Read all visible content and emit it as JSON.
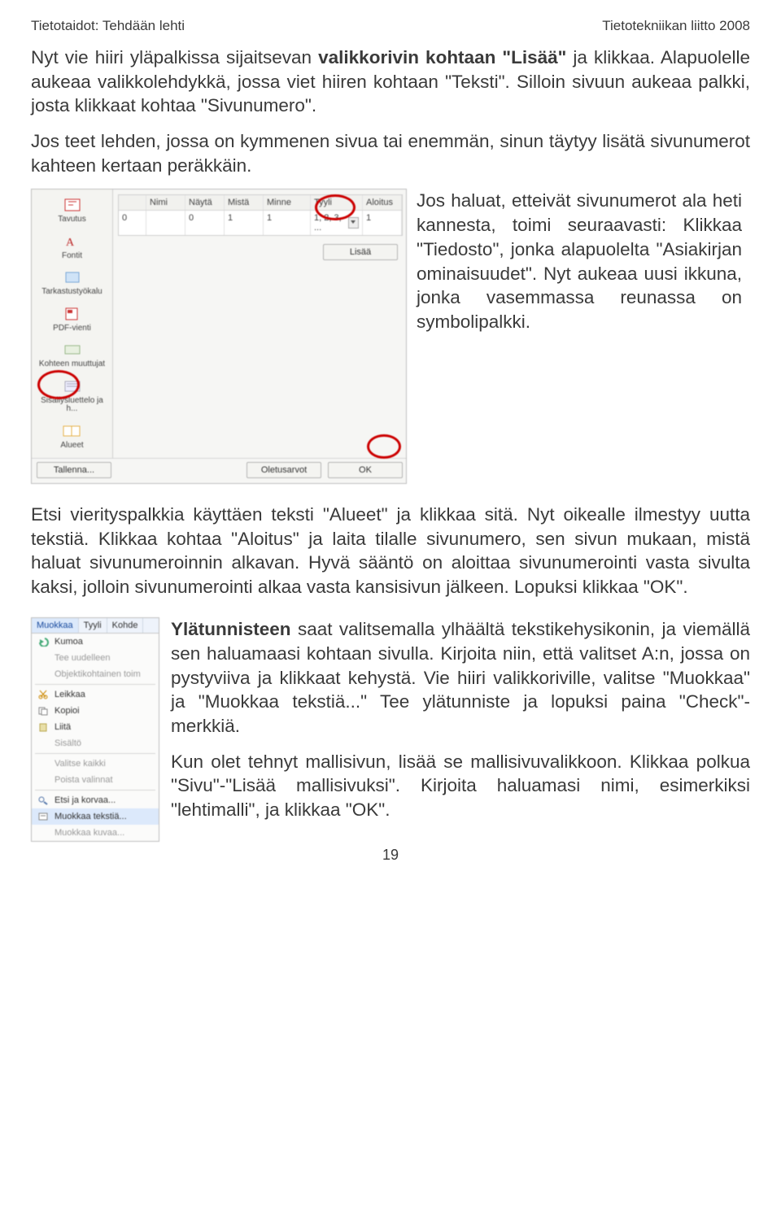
{
  "header": {
    "left": "Tietotaidot: Tehdään lehti",
    "right": "Tietotekniikan liitto 2008"
  },
  "intro": {
    "p1a": "Nyt vie hiiri yläpalkissa sijaitsevan ",
    "p1b": "valikkorivin kohtaan \"Lisää\"",
    "p1c": " ja klikkaa. Alapuolelle aukeaa valikkolehdykkä, jossa viet hiiren kohtaan \"Teksti\". Silloin sivuun aukeaa palkki, josta klikkaat kohtaa \"Sivunumero\".",
    "p2": "Jos teet lehden, jossa on kymmenen sivua tai enemmän, sinun täytyy lisätä sivunumerot kahteen kertaan peräkkäin."
  },
  "shot1": {
    "sidebar": [
      {
        "name": "tavutus",
        "label": "Tavutus"
      },
      {
        "name": "fontit",
        "label": "Fontit"
      },
      {
        "name": "tarkastus",
        "label": "Tarkastustyökalu"
      },
      {
        "name": "pdf",
        "label": "PDF-vienti"
      },
      {
        "name": "kohteen",
        "label": "Kohteen muuttujat"
      },
      {
        "name": "sisallys",
        "label": "Sisällysluettelo ja h..."
      },
      {
        "name": "alueet",
        "label": "Alueet"
      }
    ],
    "headers": [
      "",
      "Nimi",
      "Näytä",
      "Mistä",
      "Minne",
      "Tyyli",
      "Aloitus"
    ],
    "row": {
      "c0": "0",
      "c1": "",
      "c2": "0",
      "c3": "1",
      "c4": "1",
      "c5": "1, 2, 3, ...",
      "c6": "1"
    },
    "btn_add": "Lisää",
    "btn_save": "Tallenna...",
    "btn_defaults": "Oletusarvot",
    "btn_ok": "OK"
  },
  "sidecol": {
    "p1": "Jos haluat, etteivät sivunumerot ala heti kannesta, toimi seuraavasti: Klikkaa \"Tiedosto\", jonka alapuolelta \"Asiakirjan ominaisuudet\". Nyt aukeaa uusi ikkuna, jonka vasemmassa reunassa on symbolipalkki."
  },
  "after": {
    "p1": "Etsi vierityspalkkia käyttäen teksti \"Alueet\" ja klikkaa sitä. Nyt oikealle ilmestyy uutta tekstiä. Klikkaa kohtaa \"Aloitus\" ja laita tilalle sivunumero, sen sivun mukaan, mistä haluat sivunumeroinnin alkavan. Hyvä sääntö on aloittaa sivunumerointi vasta sivulta kaksi, jolloin sivunumerointi alkaa vasta kansisivun jälkeen. Lopuksi klikkaa \"OK\"."
  },
  "shot2": {
    "tabs": [
      "Muokkaa",
      "Tyyli",
      "Kohde"
    ],
    "items": [
      {
        "name": "kumoa",
        "label": "Kumoa",
        "gray": false
      },
      {
        "name": "tee-uudelleen",
        "label": "Tee uudelleen",
        "gray": true
      },
      {
        "name": "objekti",
        "label": "Objektikohtainen toim",
        "gray": true
      },
      {
        "name": "leikkaa",
        "label": "Leikkaa",
        "gray": false
      },
      {
        "name": "kopioi",
        "label": "Kopioi",
        "gray": false
      },
      {
        "name": "liita",
        "label": "Liitä",
        "gray": false
      },
      {
        "name": "sisalto",
        "label": "Sisältö",
        "gray": true
      },
      {
        "name": "valitse-kaikki",
        "label": "Valitse kaikki",
        "gray": true
      },
      {
        "name": "poista-valinnat",
        "label": "Poista valinnat",
        "gray": true
      },
      {
        "name": "etsi",
        "label": "Etsi ja korvaa...",
        "gray": false
      },
      {
        "name": "muokkaa-tekstia",
        "label": "Muokkaa tekstiä...",
        "gray": false,
        "sel": true
      },
      {
        "name": "muokkaa-kuvaa",
        "label": "Muokkaa kuvaa...",
        "gray": true
      }
    ]
  },
  "col2": {
    "p1a": "Ylätunnisteen",
    "p1b": " saat valitsemalla ylhäältä tekstikehysikonin, ja viemällä sen haluamaasi kohtaan sivulla. Kirjoita niin, että valitset A:n, jossa on pystyviiva ja klikkaat kehystä. Vie hiiri valikkoriville, valitse \"Muokkaa\" ja \"Muokkaa tekstiä...\" Tee ylätunniste ja lopuksi paina \"Check\"-merkkiä.",
    "p2": "Kun olet tehnyt mallisivun, lisää se mallisivuvalikkoon. Klikkaa polkua \"Sivu\"-\"Lisää mallisivuksi\". Kirjoita haluamasi nimi, esimerkiksi \"lehtimalli\", ja klikkaa \"OK\"."
  },
  "pagenum": "19"
}
